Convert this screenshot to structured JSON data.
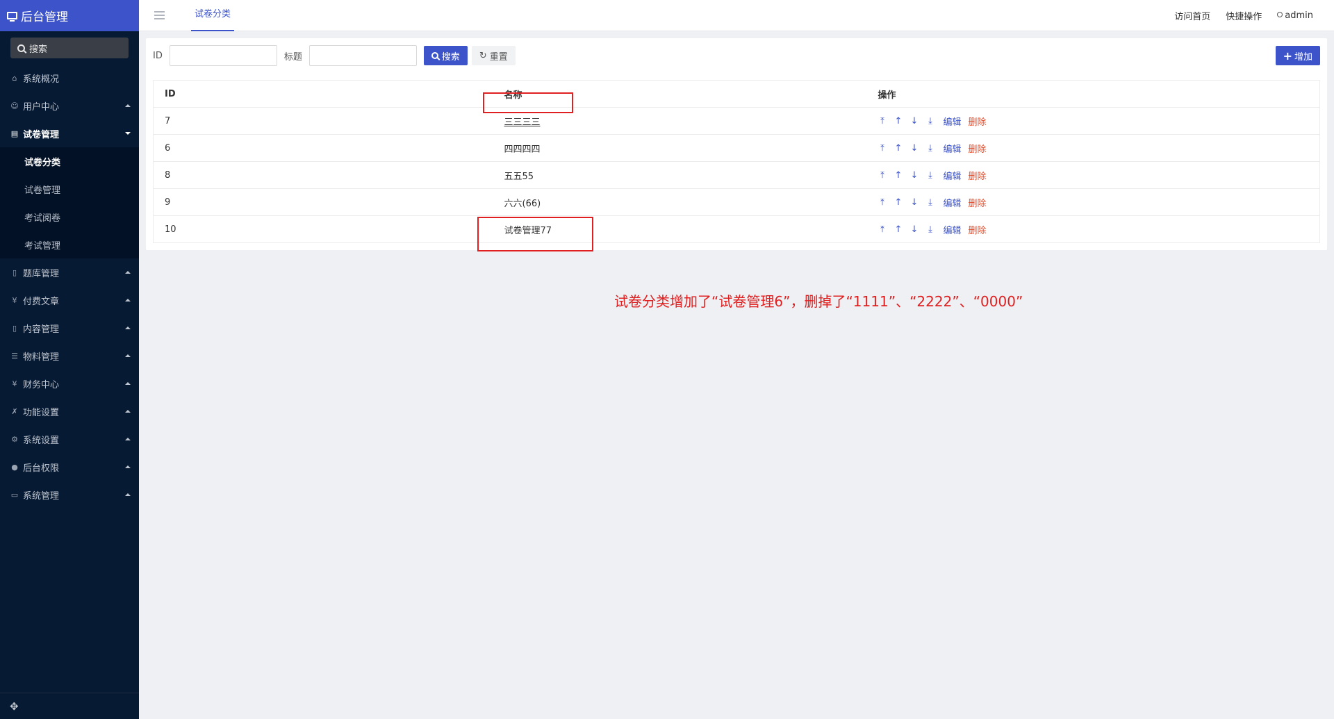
{
  "brand": {
    "title": "后台管理",
    "icon": "monitor-icon"
  },
  "sidebar": {
    "search_label": "搜索",
    "items": [
      {
        "label": "系统概况",
        "icon": "home-icon",
        "caret": false,
        "open": false
      },
      {
        "label": "用户中心",
        "icon": "users-icon",
        "caret": true,
        "open": false
      },
      {
        "label": "试卷管理",
        "icon": "exam-icon",
        "caret": true,
        "open": true,
        "children": [
          {
            "label": "试卷分类",
            "active": true
          },
          {
            "label": "试卷管理",
            "active": false
          },
          {
            "label": "考试阅卷",
            "active": false
          },
          {
            "label": "考试管理",
            "active": false
          }
        ]
      },
      {
        "label": "题库管理",
        "icon": "file-icon",
        "caret": true,
        "open": false
      },
      {
        "label": "付费文章",
        "icon": "yen-icon",
        "caret": true,
        "open": false
      },
      {
        "label": "内容管理",
        "icon": "document-icon",
        "caret": true,
        "open": false
      },
      {
        "label": "物料管理",
        "icon": "list-icon",
        "caret": true,
        "open": false
      },
      {
        "label": "财务中心",
        "icon": "yen-icon",
        "caret": true,
        "open": false
      },
      {
        "label": "功能设置",
        "icon": "tools-icon",
        "caret": true,
        "open": false
      },
      {
        "label": "系统设置",
        "icon": "gear-icon",
        "caret": true,
        "open": false
      },
      {
        "label": "后台权限",
        "icon": "user-circle-icon",
        "caret": true,
        "open": false
      },
      {
        "label": "系统管理",
        "icon": "chart-icon",
        "caret": true,
        "open": false
      }
    ]
  },
  "header": {
    "tab": "试卷分类",
    "links": [
      "访问首页",
      "快捷操作"
    ],
    "user": "admin"
  },
  "filter": {
    "id_label": "ID",
    "title_label": "标题",
    "id_value": "",
    "title_value": "",
    "search_button": "搜索",
    "reset_button": "重置",
    "add_button": "增加"
  },
  "table": {
    "columns": [
      "ID",
      "名称",
      "操作"
    ],
    "rows": [
      {
        "id": "7",
        "name": "三三三三"
      },
      {
        "id": "6",
        "name": "四四四四"
      },
      {
        "id": "8",
        "name": "五五55"
      },
      {
        "id": "9",
        "name": "六六(66)"
      },
      {
        "id": "10",
        "name": "试卷管理77"
      }
    ],
    "op_edit": "编辑",
    "op_delete": "删除",
    "op_icons": [
      "top-icon",
      "up-icon",
      "down-icon",
      "bottom-icon"
    ]
  },
  "annotation": "试卷分类增加了“试卷管理6”，删掉了“1111”、“2222”、“0000”",
  "colors": {
    "accent": "#3c53c9",
    "sidebar_bg": "#061a33",
    "danger": "#e24b2a",
    "annotation": "#e02020"
  }
}
